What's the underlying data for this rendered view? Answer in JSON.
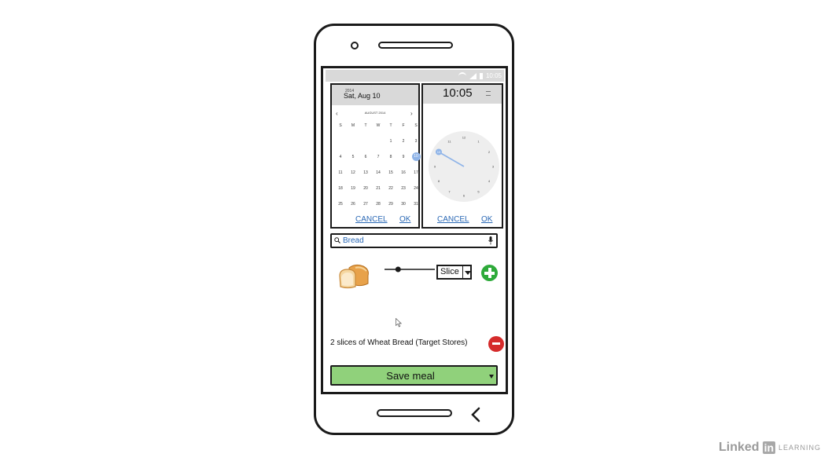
{
  "status_bar": {
    "time": "10:05"
  },
  "date_picker": {
    "year": "2014",
    "date_label": "Sat, Aug 10",
    "month_label": "AUGUST 2014",
    "weekdays": [
      "S",
      "M",
      "T",
      "W",
      "T",
      "F",
      "S"
    ],
    "days": [
      "",
      "",
      "",
      "",
      "1",
      "2",
      "3",
      "4",
      "5",
      "6",
      "7",
      "8",
      "9",
      "10",
      "11",
      "12",
      "13",
      "14",
      "15",
      "16",
      "17",
      "18",
      "19",
      "20",
      "21",
      "22",
      "23",
      "24",
      "25",
      "26",
      "27",
      "28",
      "29",
      "30",
      "31"
    ],
    "selected_day": "10",
    "cancel_label": "CANCEL",
    "ok_label": "OK"
  },
  "time_picker": {
    "time": "10:05",
    "hours": [
      "12",
      "1",
      "2",
      "3",
      "4",
      "5",
      "6",
      "7",
      "8",
      "9",
      "10",
      "11"
    ],
    "selected_hour": "10",
    "cancel_label": "CANCEL",
    "ok_label": "OK"
  },
  "search": {
    "value": "Bread"
  },
  "food": {
    "unit": "Slice",
    "slider_level": 0.27,
    "entry": "2 slices of Wheat Bread (Target Stores)"
  },
  "save": {
    "label": "Save meal"
  },
  "watermark": {
    "brand": "Linked",
    "in": "in",
    "suffix": "LEARNING"
  },
  "colors": {
    "accent": "#2a68b5",
    "save_green": "#90d17b",
    "add_green": "#2eaa3a",
    "remove_red": "#d52b2b"
  }
}
